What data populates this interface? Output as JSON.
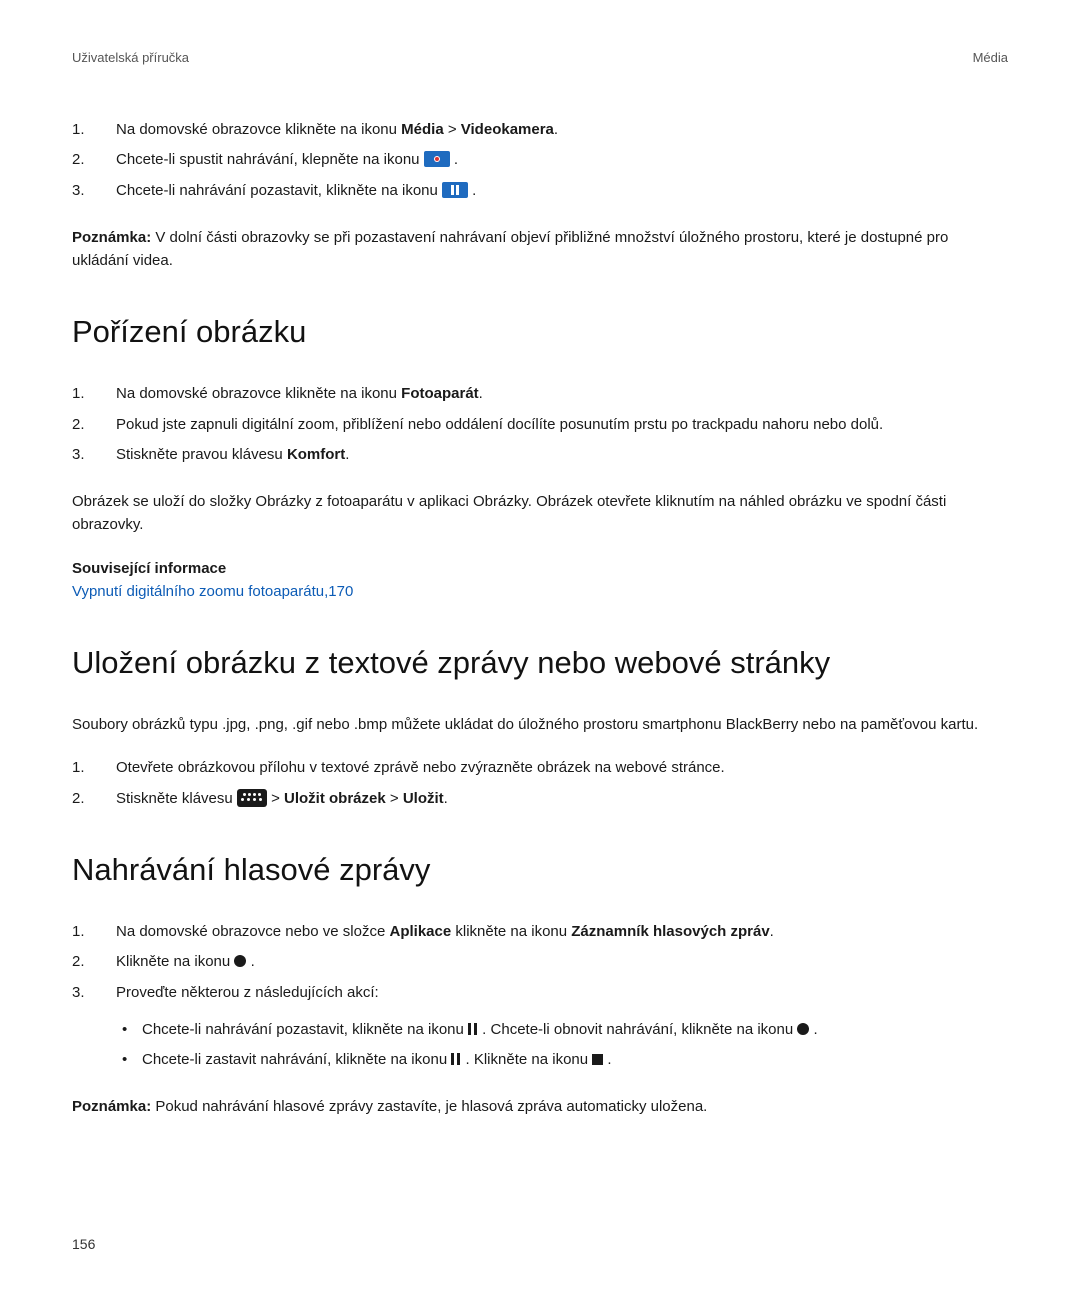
{
  "header": {
    "left": "Uživatelská příručka",
    "right": "Média"
  },
  "section_a": {
    "items": {
      "0": {
        "pre": "Na domovské obrazovce klikněte na ikonu ",
        "bold1": "Média",
        "sep": " > ",
        "bold2": "Videokamera",
        "post": "."
      },
      "1": {
        "pre": "Chcete-li spustit nahrávání, klepněte na ikonu ",
        "post": " ."
      },
      "2": {
        "pre": "Chcete-li nahrávání pozastavit, klikněte na ikonu ",
        "post": " ."
      }
    },
    "note_label": "Poznámka:",
    "note_text": " V dolní části obrazovky se při pozastavení nahrávaní objeví přibližné množství úložného prostoru, které je dostupné pro ukládání videa."
  },
  "section_b": {
    "heading": "Pořízení obrázku",
    "items": {
      "0": {
        "pre": "Na domovské obrazovce klikněte na ikonu ",
        "bold1": "Fotoaparát",
        "post": "."
      },
      "1": {
        "text": "Pokud jste zapnuli digitální zoom, přiblížení nebo oddálení docílíte posunutím prstu po trackpadu nahoru nebo dolů."
      },
      "2": {
        "pre": "Stiskněte pravou klávesu ",
        "bold1": "Komfort",
        "post": "."
      }
    },
    "para": "Obrázek se uloží do složky Obrázky z fotoaparátu v aplikaci Obrázky. Obrázek otevřete kliknutím na náhled obrázku ve spodní části obrazovky.",
    "related_hdr": "Související informace",
    "related_link": "Vypnutí digitálního zoomu fotoaparátu,",
    "related_page": "170"
  },
  "section_c": {
    "heading": "Uložení obrázku z textové zprávy nebo webové stránky",
    "para": "Soubory obrázků typu .jpg, .png, .gif nebo .bmp můžete ukládat do úložného prostoru smartphonu BlackBerry nebo na paměťovou kartu.",
    "items": {
      "0": {
        "text": "Otevřete obrázkovou přílohu v textové zprávě nebo zvýrazněte obrázek na webové stránce."
      },
      "1": {
        "pre": "Stiskněte klávesu ",
        "sep": "  > ",
        "bold1": "Uložit obrázek",
        "sep2": " > ",
        "bold2": "Uložit",
        "post": "."
      }
    }
  },
  "section_d": {
    "heading": "Nahrávání hlasové zprávy",
    "items": {
      "0": {
        "pre": "Na domovské obrazovce nebo ve složce ",
        "bold1": "Aplikace",
        "mid": " klikněte na ikonu ",
        "bold2": "Záznamník hlasových zpráv",
        "post": "."
      },
      "1": {
        "pre": "Klikněte na ikonu ",
        "post": " ."
      },
      "2": {
        "text": "Proveďte některou z následujících akcí:",
        "sub": {
          "0": {
            "pre": "Chcete-li nahrávání pozastavit, klikněte na ikonu ",
            "mid": " . Chcete-li obnovit nahrávání, klikněte na ikonu ",
            "post": " ."
          },
          "1": {
            "pre": "Chcete-li zastavit nahrávání, klikněte na ikonu ",
            "mid": " . Klikněte na ikonu ",
            "post": " ."
          }
        }
      }
    },
    "note_label": "Poznámka:",
    "note_text": " Pokud nahrávání hlasové zprávy zastavíte, je hlasová zpráva automaticky uložena."
  },
  "page_number": "156"
}
